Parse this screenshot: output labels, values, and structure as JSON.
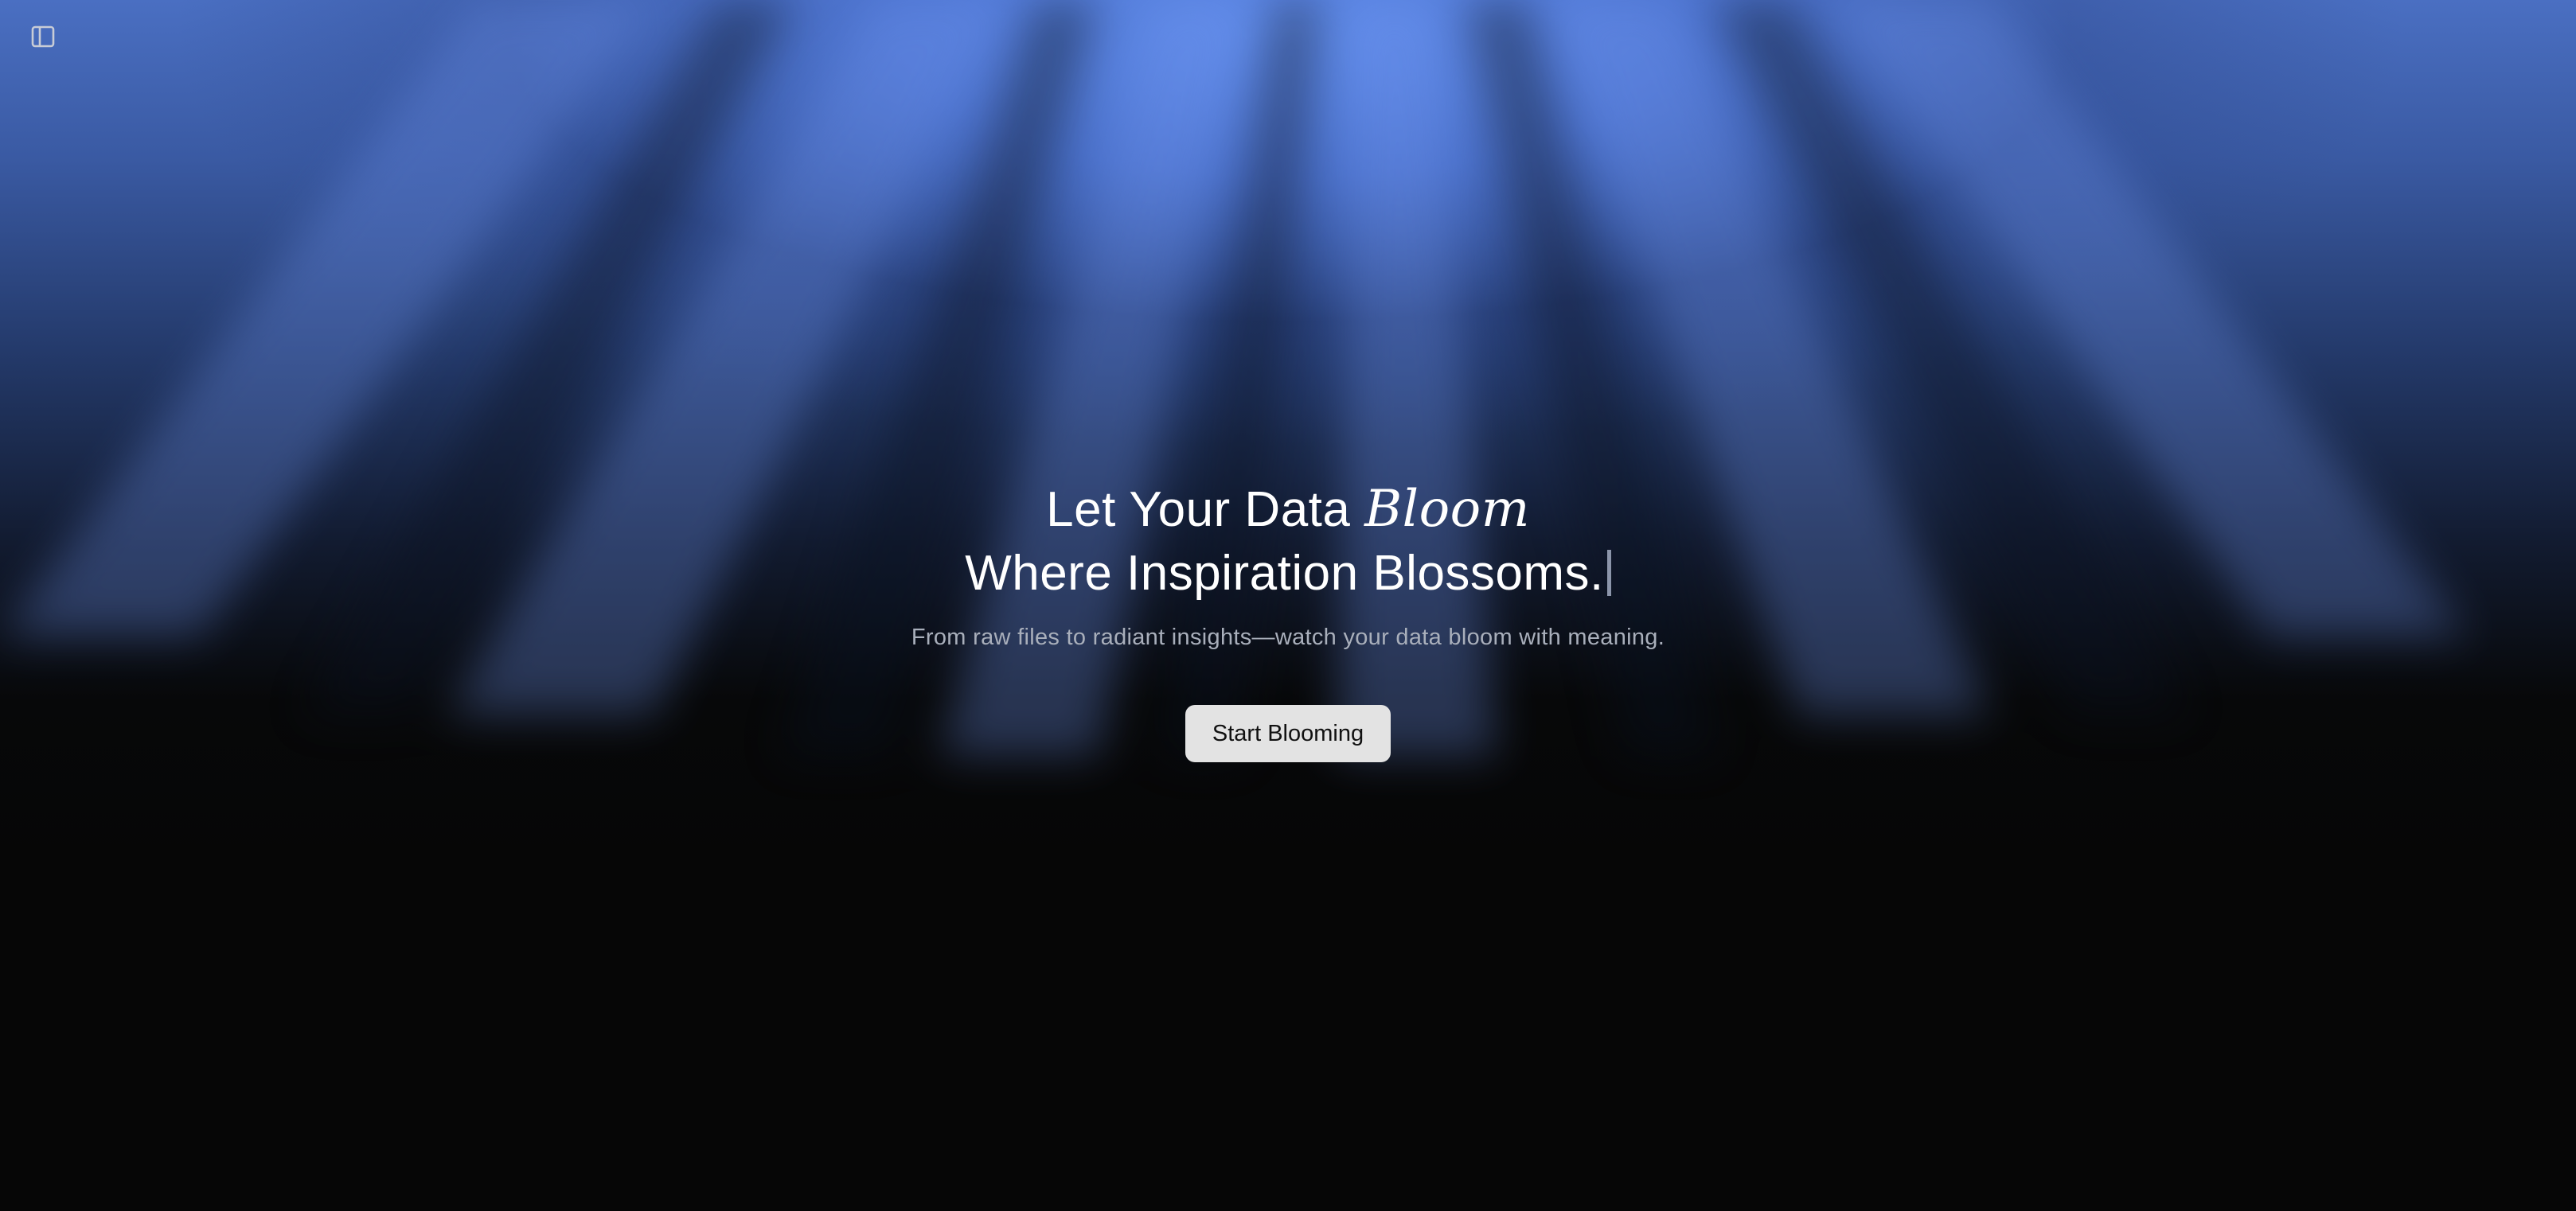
{
  "sidebar": {
    "toggle_icon": "sidebar-panel-icon"
  },
  "hero": {
    "line1_prefix": "Let Your Data",
    "line1_emphasis": "Bloom",
    "line2": "Where Inspiration Blossoms.",
    "subtitle": "From raw files to radiant insights—watch your data bloom with meaning.",
    "cta_label": "Start Blooming"
  },
  "colors": {
    "background": "#060606",
    "glow_blue": "#5b82e0",
    "button_bg": "#e3e3e3",
    "subtitle_text": "#a9afbb"
  }
}
